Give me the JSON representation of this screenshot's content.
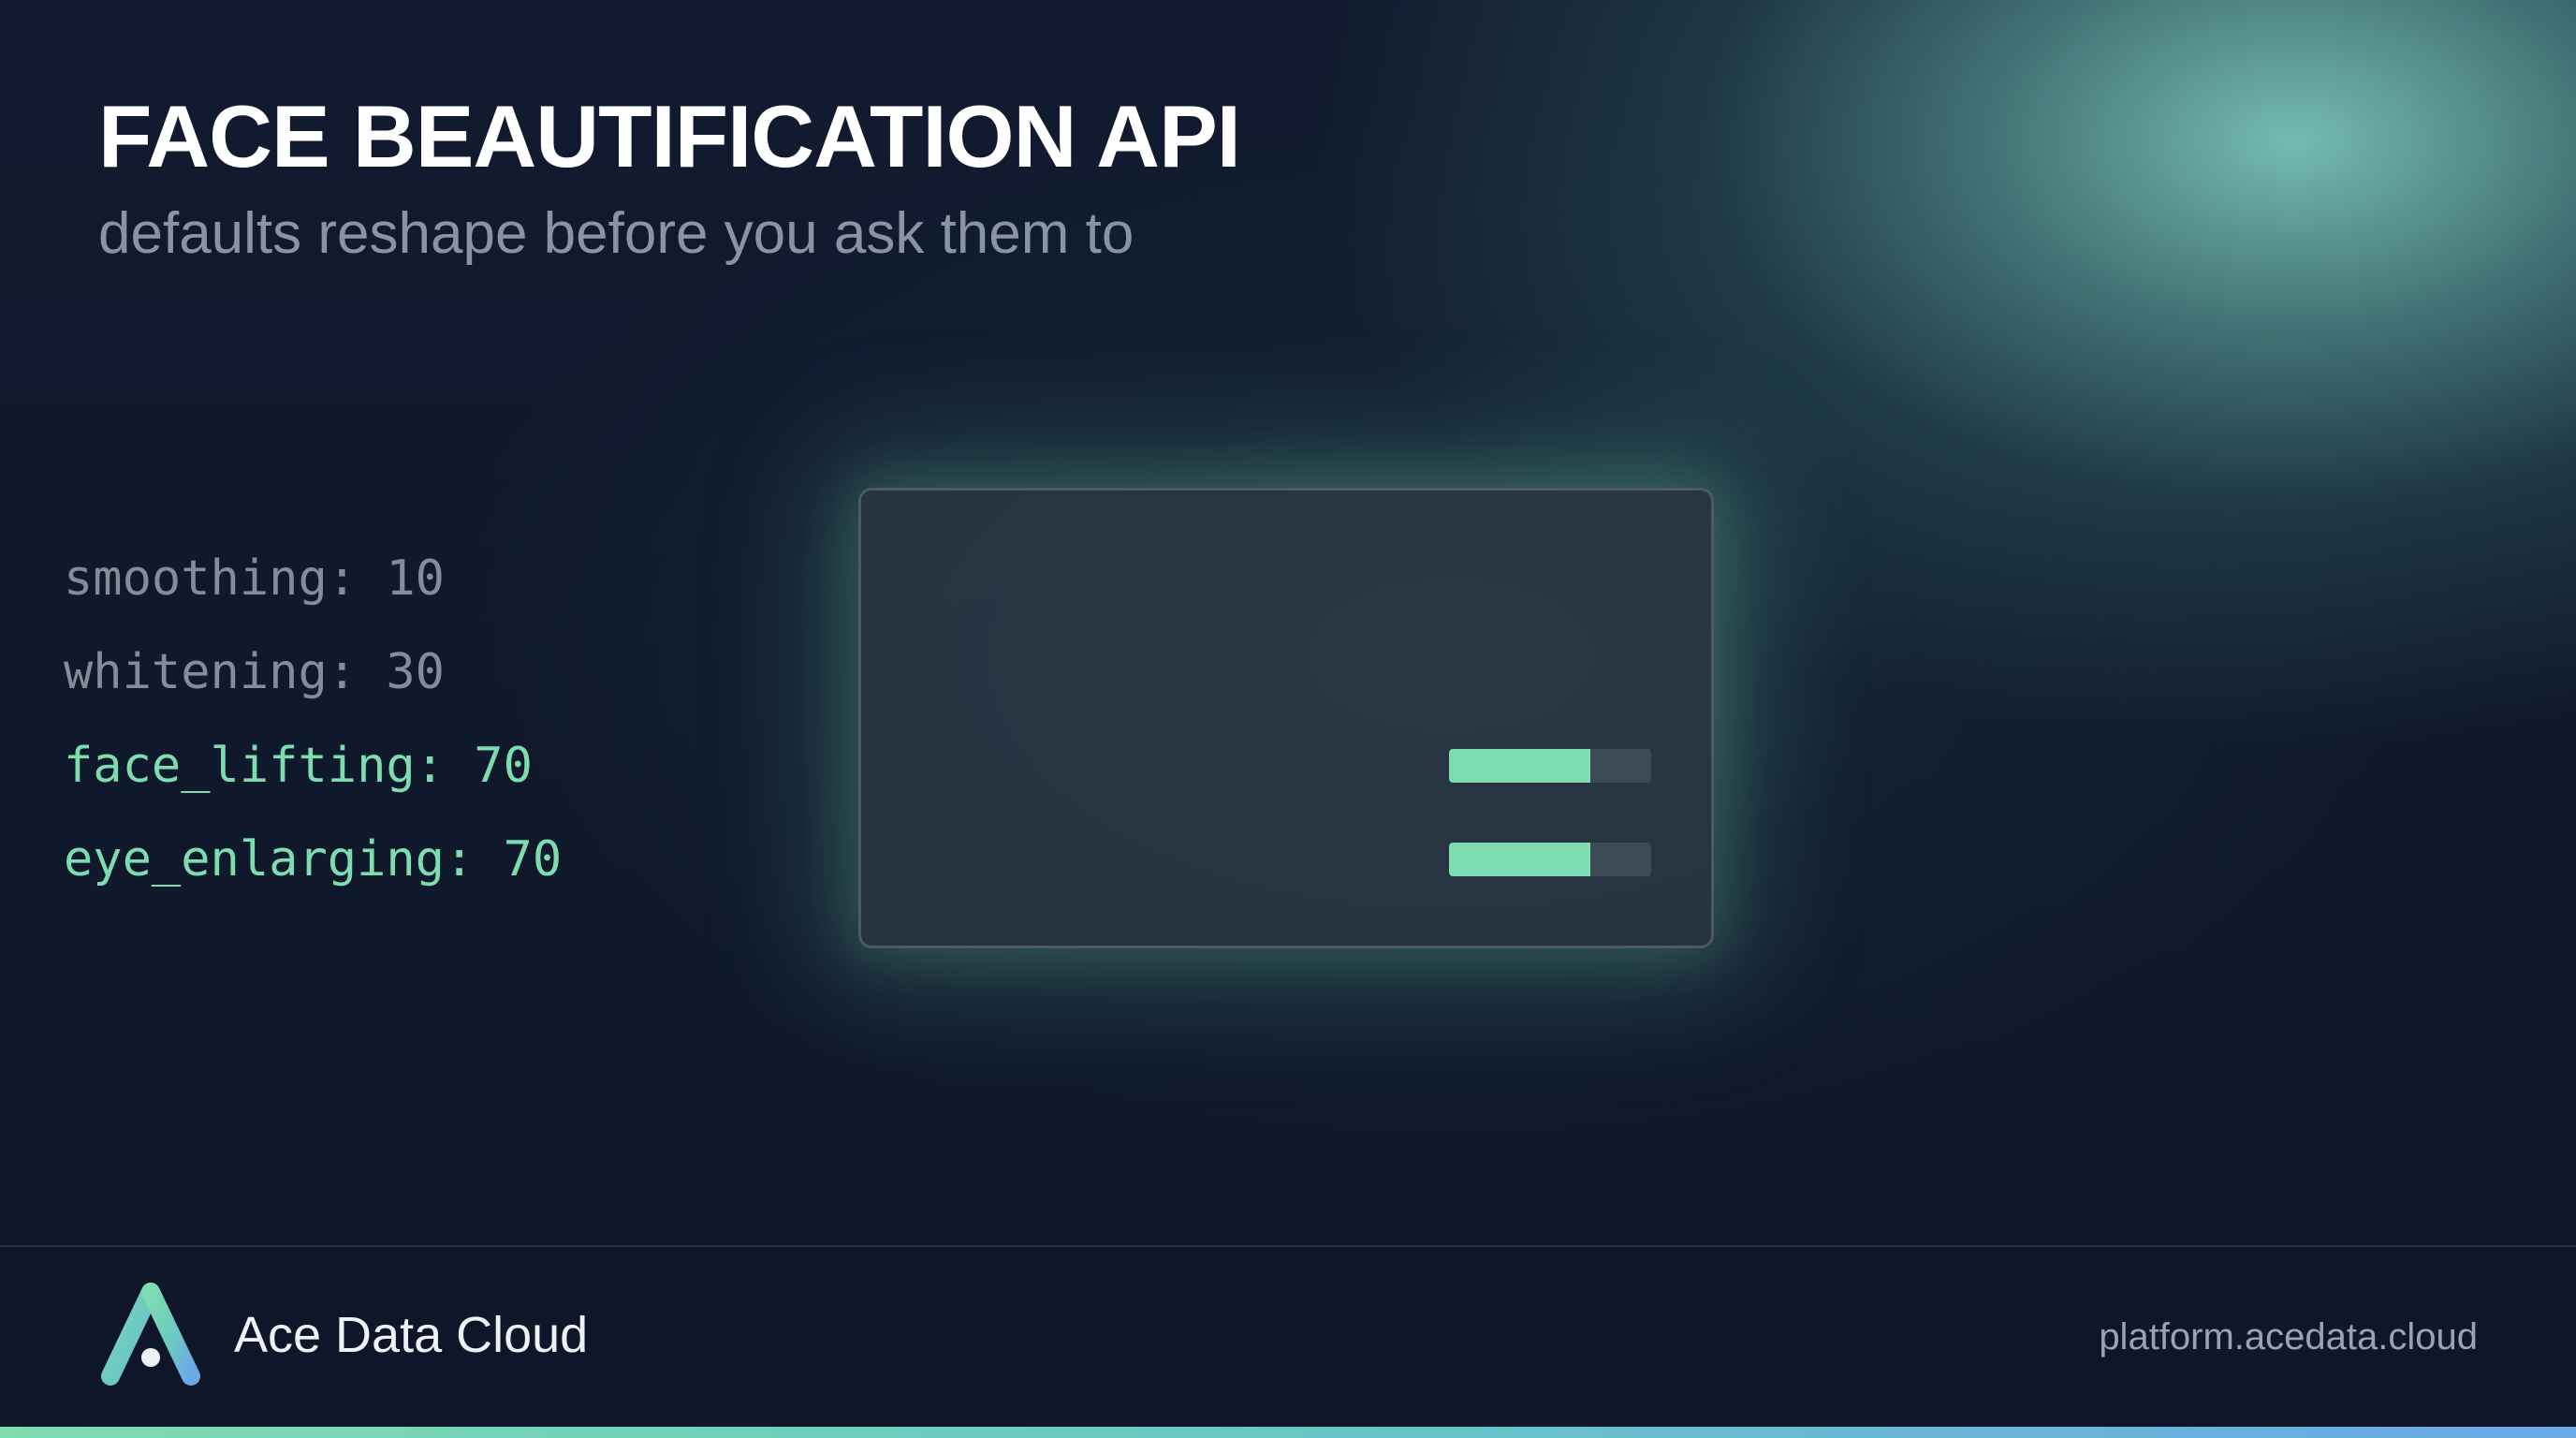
{
  "header": {
    "title": "FACE BEAUTIFICATION API",
    "subtitle": "defaults reshape before you ask them to"
  },
  "parameters": [
    {
      "label": "smoothing: 10",
      "name": "smoothing",
      "value": 10,
      "highlighted": false
    },
    {
      "label": "whitening: 30",
      "name": "whitening",
      "value": 30,
      "highlighted": false
    },
    {
      "label": "face_lifting: 70",
      "name": "face_lifting",
      "value": 70,
      "highlighted": true,
      "bar_fraction": 0.7
    },
    {
      "label": "eye_enlarging: 70",
      "name": "eye_enlarging",
      "value": 70,
      "highlighted": true,
      "bar_fraction": 0.7
    }
  ],
  "footer": {
    "brand": "Ace Data Cloud",
    "url": "platform.acedata.cloud",
    "logo_icon": "ace-data-cloud-logo-icon"
  },
  "colors": {
    "background": "#0f1629",
    "accent_green": "#7ddcb0",
    "dim_text": "#858c98",
    "panel_border": "#4b5a68",
    "bar_track": "#3c4b55",
    "accent_blue": "#6aa8e8"
  }
}
